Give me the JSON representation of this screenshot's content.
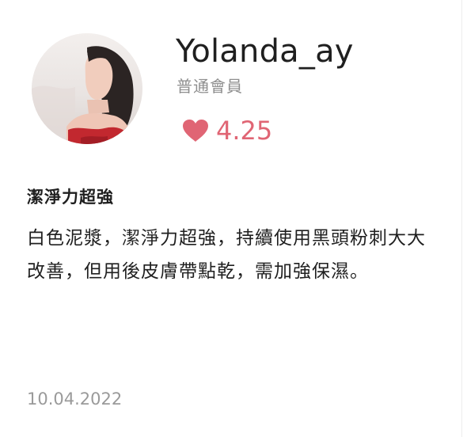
{
  "reviewer": {
    "username": "Yolanda_ay",
    "member_level": "普通會員",
    "rating": "4.25",
    "avatar_icon": "reviewer-avatar-photo"
  },
  "review": {
    "title": "潔淨力超強",
    "body": "白色泥漿，潔淨力超強，持續使用黑頭粉刺大大改善，但用後皮膚帶點乾，需加強保濕。",
    "date": "10.04.2022"
  },
  "colors": {
    "rating_accent": "#e06574",
    "text_primary": "#1f1f1f",
    "text_secondary": "#8e8e8e",
    "date_text": "#9a9a9a"
  },
  "icons": {
    "rating": "heart-icon"
  }
}
